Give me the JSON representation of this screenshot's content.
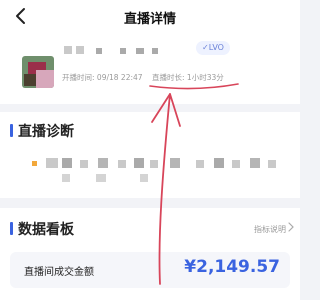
{
  "nav": {
    "title": "直播详情",
    "back_icon": "chevron-left-icon"
  },
  "live_info": {
    "badge": "LVO",
    "start_label": "开播时间:",
    "start_value": "09/18 22:47",
    "duration_label": "直播时长:",
    "duration_value": "1小时33分"
  },
  "diagnosis": {
    "title": "直播诊断"
  },
  "dashboard": {
    "title": "数据看板",
    "hint": "指标说明",
    "card_label": "直播间成交金额",
    "card_value": "¥2,149.57"
  },
  "colors": {
    "accent": "#3a63e0",
    "annotation": "#d8455a"
  }
}
